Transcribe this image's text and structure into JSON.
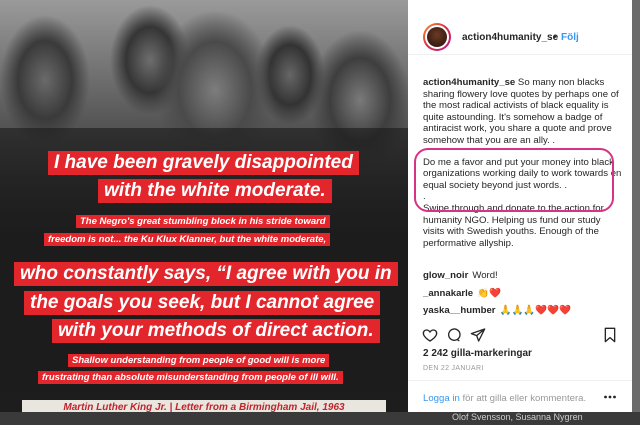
{
  "post": {
    "image_quote": {
      "big_line_1": "I have been gravely disappointed",
      "big_line_2": "with the white moderate.",
      "small_line_1": "The Negro's great stumbling block in his stride toward",
      "small_line_2": "freedom is not... the Ku Klux Klanner, but the white moderate,",
      "big_line_3": "who constantly says, “I agree with you in",
      "big_line_4": "the goals you seek, but I cannot agree",
      "big_line_5": "with your methods of direct action.",
      "small_line_3": "Shallow understanding from people of good will is more",
      "small_line_4": "frustrating than absolute misunderstanding from people of ill will.",
      "attribution": "Martin Luther King Jr.  |  Letter from a Birmingham Jail, 1963"
    }
  },
  "sidebar": {
    "username": "action4humanity_se",
    "separator": "•",
    "follow_label": "Följ",
    "caption": {
      "username": "action4humanity_se",
      "text_1": "So many non blacks sharing flowery love quotes by perhaps one of the most radical activists of black equality is quite astounding. It's somehow a badge of antiracist work, you share a quote and prove somehow that you are an ally. .",
      "text_2": "Do me a favor and put your money into black organizations working daily to work towards en equal society beyond just words. .",
      "text_3": ".",
      "text_4": "Swipe through and donate to the action for humanity NGO. Helping us fund our study visits with Swedish youths. Enough of the performative allyship."
    },
    "comments": [
      {
        "user": "glow_noir",
        "text": "Word!"
      },
      {
        "user": "_annakarle",
        "text": "👏❤️"
      },
      {
        "user": "yaska__humber",
        "text": "🙏🙏🙏❤️❤️❤️"
      }
    ],
    "likes": "2 242 gilla-markeringar",
    "date": "DEN 22 JANUARI",
    "login_link": "Logga in",
    "login_text": " för att gilla eller kommentera.",
    "more_icon": "ellipsis-icon"
  },
  "background": {
    "partial_text": "Olof Svensson, Susanna Nygren"
  },
  "colors": {
    "quote_red": "#e3262b",
    "link_blue": "#3897f0",
    "highlight_pink": "#d63384"
  }
}
